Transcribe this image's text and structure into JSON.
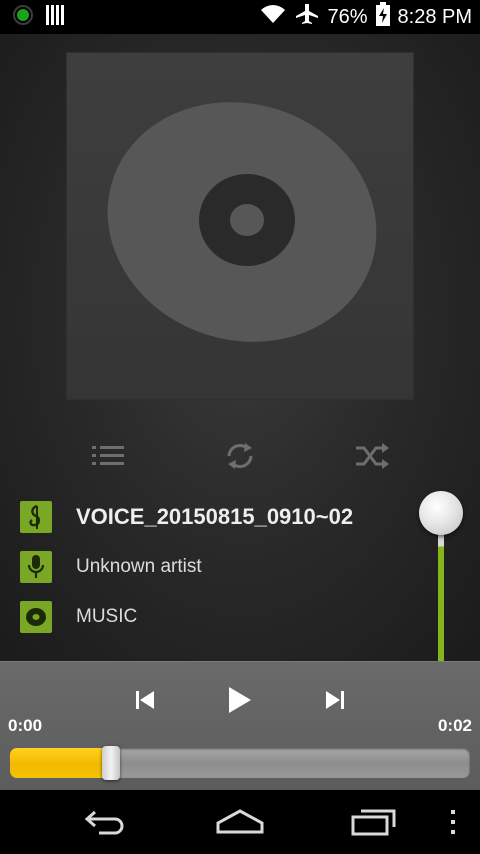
{
  "statusbar": {
    "battery_percent": "76%",
    "time": "8:28 PM"
  },
  "track": {
    "title": "VOICE_20150815_0910~02",
    "artist": "Unknown artist",
    "album": "MUSIC"
  },
  "player": {
    "elapsed": "0:00",
    "duration": "0:02",
    "progress_fraction": 0.22,
    "volume_fraction": 0.85
  },
  "colors": {
    "accent_green": "#86b51b",
    "seek_yellow": "#f4b800"
  },
  "icons": {
    "playlist": "playlist-icon",
    "repeat": "repeat-icon",
    "shuffle": "shuffle-icon",
    "previous": "previous-icon",
    "play": "play-icon",
    "next": "next-icon",
    "back": "back-icon",
    "home": "home-icon",
    "recents": "recents-icon",
    "menu": "overflow-menu-icon"
  }
}
